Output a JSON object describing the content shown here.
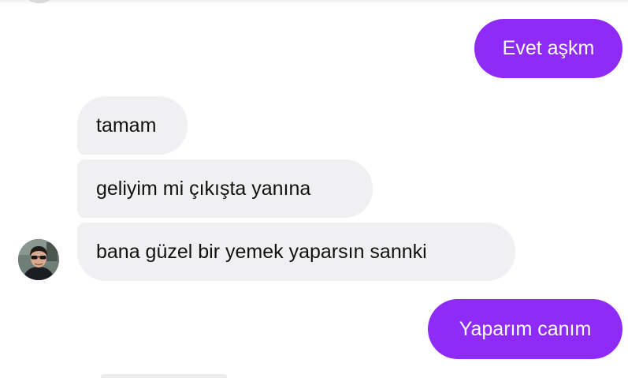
{
  "messages": [
    {
      "text": "Evet aşkm",
      "direction": "outgoing"
    },
    {
      "text": "tamam",
      "direction": "incoming"
    },
    {
      "text": "geliyim mi çıkışta yanına",
      "direction": "incoming"
    },
    {
      "text": "bana güzel bir yemek yaparsın sannki",
      "direction": "incoming"
    },
    {
      "text": "Yaparım canım",
      "direction": "outgoing"
    }
  ],
  "colors": {
    "outgoing_bubble": "#8f2bf7",
    "incoming_bubble": "#f0f0f3",
    "background": "#ffffff"
  }
}
